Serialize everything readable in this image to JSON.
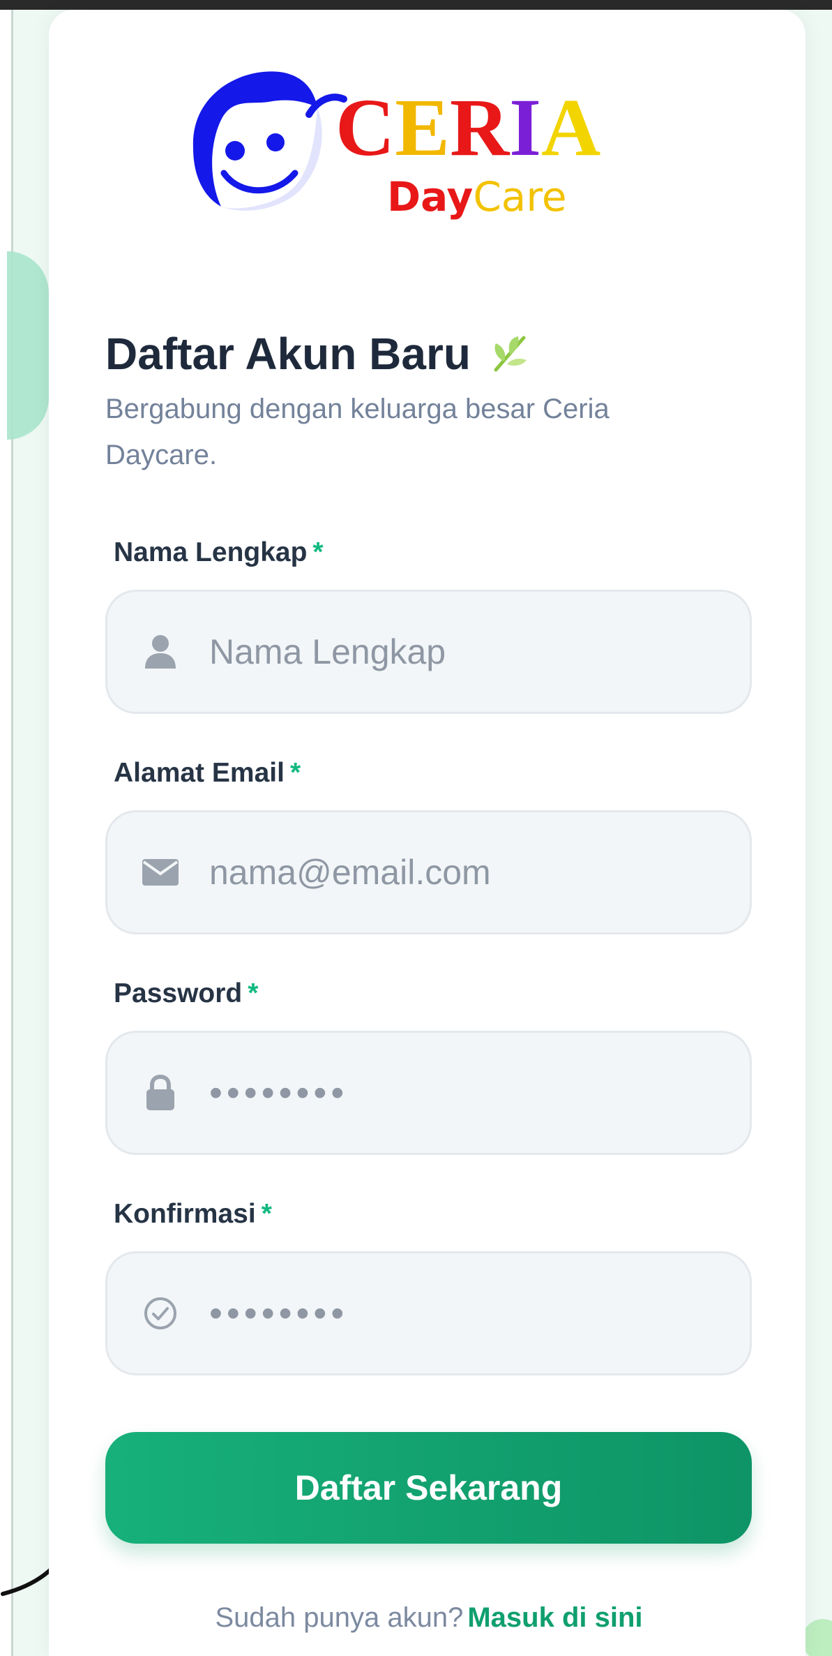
{
  "brand": {
    "logo_text": "CERIA",
    "logo_sub_1": "Day",
    "logo_sub_2": "Care"
  },
  "header": {
    "title": "Daftar Akun Baru",
    "title_icon": "sprout-icon",
    "subtitle": "Bergabung dengan keluarga besar Ceria Daycare."
  },
  "form": {
    "required_mark": "*",
    "name": {
      "label": "Nama Lengkap",
      "placeholder": "Nama Lengkap",
      "icon": "user-icon"
    },
    "email": {
      "label": "Alamat Email",
      "placeholder": "nama@email.com",
      "icon": "envelope-icon"
    },
    "password": {
      "label": "Password",
      "placeholder": "••••••••",
      "icon": "lock-icon"
    },
    "confirm": {
      "label": "Konfirmasi",
      "placeholder": "••••••••",
      "icon": "check-circle-icon"
    },
    "submit_label": "Daftar Sekarang"
  },
  "footer": {
    "prompt": "Sudah punya akun?",
    "link": "Masuk di sini"
  },
  "colors": {
    "accent": "#10b981",
    "accent_dark": "#0e9466",
    "title": "#1e2a3b",
    "muted": "#73829a",
    "input_bg": "#f3f6f8"
  }
}
